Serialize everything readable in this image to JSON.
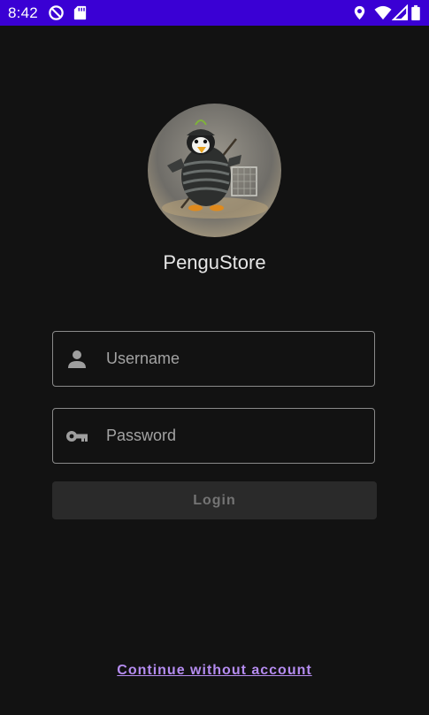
{
  "status_bar": {
    "time": "8:42",
    "background_color": "#3a00d4",
    "icons": [
      "do-not-disturb-icon",
      "sd-card-icon",
      "location-icon",
      "wifi-icon",
      "signal-icon",
      "battery-icon"
    ]
  },
  "app": {
    "title": "PenguStore",
    "avatar_icon": "penguin-samurai-avatar"
  },
  "login_form": {
    "username": {
      "placeholder": "Username",
      "value": "",
      "icon": "person-icon"
    },
    "password": {
      "placeholder": "Password",
      "value": "",
      "icon": "key-icon"
    },
    "login_label": "Login"
  },
  "footer": {
    "continue_label": "Continue without account",
    "link_color": "#b58cf0"
  }
}
